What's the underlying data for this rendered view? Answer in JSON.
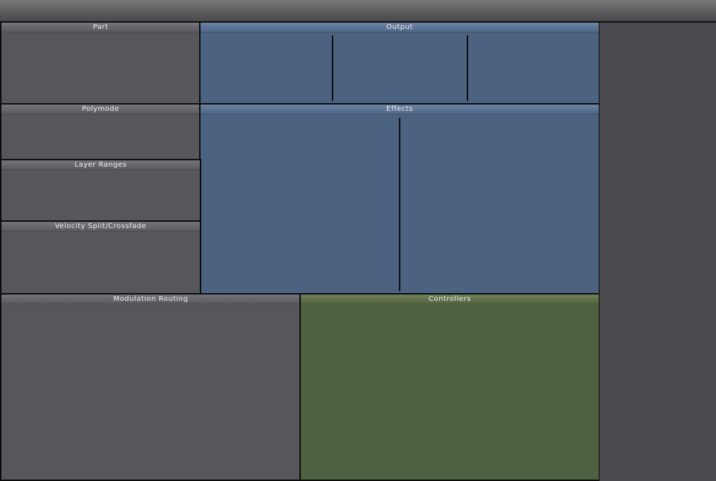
{
  "panels": {
    "part": {
      "title": "Part"
    },
    "output": {
      "title": "Output"
    },
    "polymode": {
      "title": "Polymode"
    },
    "effects": {
      "title": "Effects"
    },
    "layer_ranges": {
      "title": "Layer Ranges"
    },
    "velocity": {
      "title": "Velocity Split/Crossfade"
    },
    "modulation": {
      "title": "Modulation Routing"
    },
    "controllers": {
      "title": "Controllers"
    }
  },
  "colors": {
    "gray_panel": "#57575b",
    "blue_panel": "#4b6281",
    "green_panel": "#506141",
    "background": "#4a4a4e"
  }
}
